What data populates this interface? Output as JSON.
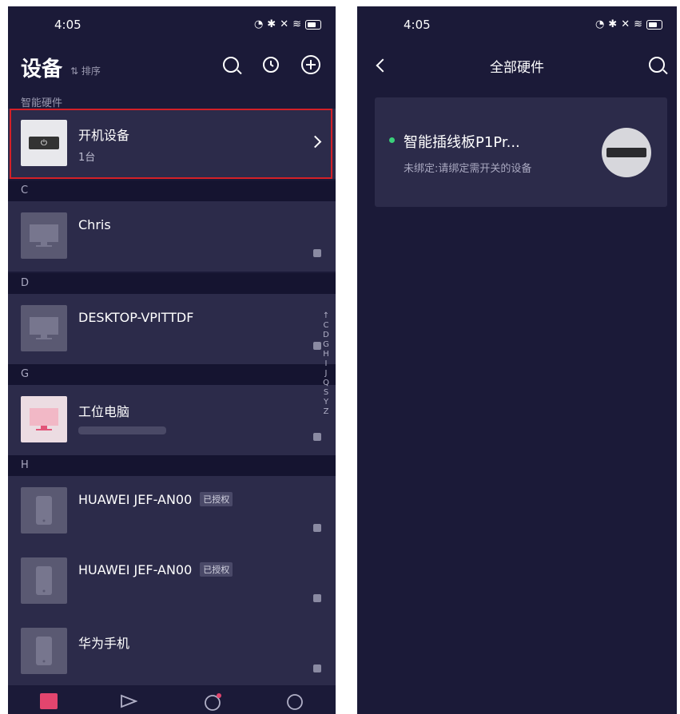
{
  "left": {
    "status": {
      "time": "4:05"
    },
    "header": {
      "title": "设备",
      "sort_label": "⇅ 排序"
    },
    "section_label": "智能硬件",
    "smart_row": {
      "name": "开机设备",
      "count": "1台"
    },
    "groups": [
      {
        "letter": "C",
        "rows": [
          {
            "name": "Chris",
            "sub": ""
          }
        ]
      },
      {
        "letter": "D",
        "rows": [
          {
            "name": "DESKTOP-VPITTDF",
            "sub": ""
          }
        ]
      },
      {
        "letter": "G",
        "rows": [
          {
            "name": "工位电脑",
            "sub": ""
          }
        ]
      },
      {
        "letter": "H",
        "rows": [
          {
            "name": "HUAWEI JEF-AN00",
            "badge": "已授权"
          },
          {
            "name": "HUAWEI JEF-AN00",
            "badge": "已授权"
          },
          {
            "name": "华为手机"
          }
        ]
      }
    ],
    "index_letters": [
      "↑",
      "C",
      "D",
      "G",
      "H",
      "I",
      "J",
      "Q",
      "S",
      "Y",
      "Z"
    ]
  },
  "right": {
    "status": {
      "time": "4:05"
    },
    "header": {
      "title": "全部硬件"
    },
    "card": {
      "name": "智能插线板P1Pr...",
      "status": "未绑定:请绑定需开关的设备"
    }
  }
}
